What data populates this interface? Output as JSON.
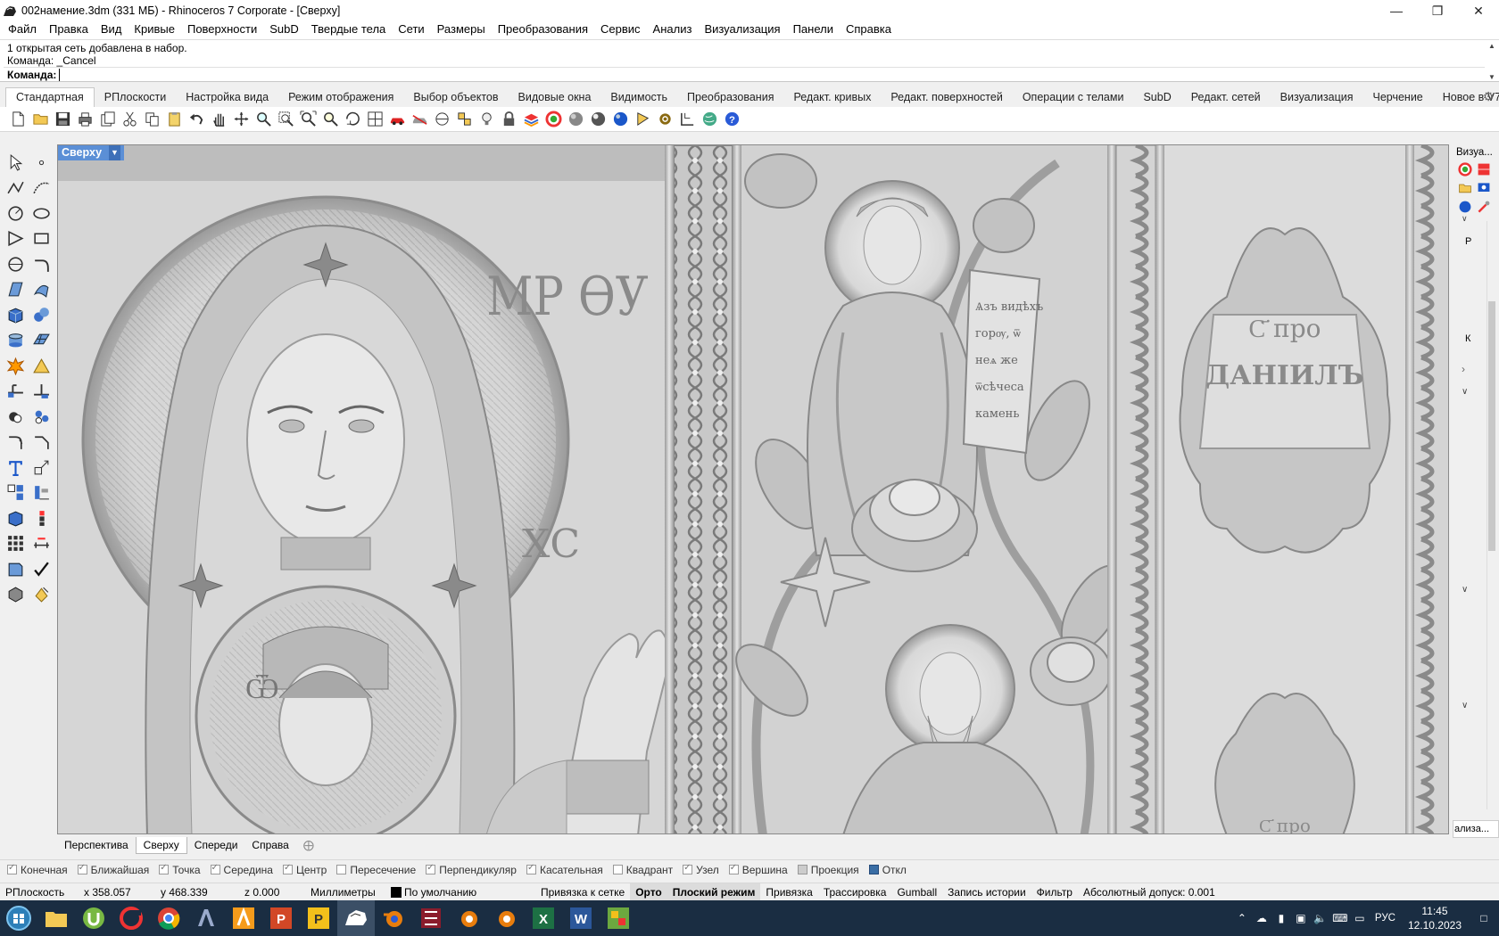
{
  "window": {
    "title": "002намение.3dm (331 МБ) - Rhinoceros 7 Corporate - [Сверху]"
  },
  "menu": [
    "Файл",
    "Правка",
    "Вид",
    "Кривые",
    "Поверхности",
    "SubD",
    "Твердые тела",
    "Сети",
    "Размеры",
    "Преобразования",
    "Сервис",
    "Анализ",
    "Визуализация",
    "Панели",
    "Справка"
  ],
  "command": {
    "history": [
      "1 открытая сеть добавлена в набор.",
      "Команда: _Cancel"
    ],
    "prompt_label": "Команда:",
    "input_value": ""
  },
  "toolbar_tabs": [
    "Стандартная",
    "РПлоскости",
    "Настройка вида",
    "Режим отображения",
    "Выбор объектов",
    "Видовые окна",
    "Видимость",
    "Преобразования",
    "Редакт. кривых",
    "Редакт. поверхностей",
    "Операции с телами",
    "SubD",
    "Редакт. сетей",
    "Визуализация",
    "Черчение",
    "Новое в V7"
  ],
  "active_tab": "Стандартная",
  "toolbar_icons": [
    "new-file-icon",
    "open-folder-icon",
    "save-icon",
    "print-icon",
    "import-icon",
    "cut-icon",
    "copy-icon",
    "paste-icon",
    "undo-icon",
    "pan-hand-icon",
    "rotate-view-icon",
    "zoom-icon",
    "zoom-window-icon",
    "zoom-extents-icon",
    "zoom-selected-icon",
    "zoom-dynamic-icon",
    "four-viewports-icon",
    "car-icon",
    "split-car-icon",
    "circle-target-icon",
    "grid-points-icon",
    "light-bulb-icon",
    "lock-icon",
    "layers-icon",
    "color-wheel-icon",
    "sphere-icon",
    "render-sphere-icon",
    "blue-sphere-icon",
    "properties-icon",
    "gear-icon",
    "dimension-icon",
    "earth-icon",
    "help-icon"
  ],
  "left_tools": [
    "select-arrow-icon",
    "point-icon",
    "polyline-icon",
    "curve-points-icon",
    "circle-icon",
    "arc-icon",
    "triangle-icon",
    "rectangle-icon",
    "ellipse-icon",
    "spiral-icon",
    "surface-pts-icon",
    "surface-icon",
    "box-icon",
    "spheres-icon",
    "cylinder-icon",
    "mesh-icon",
    "explode-icon",
    "extrude-icon",
    "trim-icon",
    "split-icon",
    "boolean-icon",
    "group-icon",
    "fillet-icon",
    "chamfer-icon",
    "text-icon",
    "transform-icon",
    "array-icon",
    "scale-icon",
    "box-edit-icon",
    "blocks-icon",
    "grid-array-icon",
    "dims-icon",
    "ortho-icon",
    "check-icon",
    "solid-icon",
    "paint-icon"
  ],
  "viewport": {
    "label": "Сверху",
    "scene_text": {
      "monogram_mary": "МР ѲУ",
      "monogram_christ": "ХС",
      "iota": "Ѿ",
      "scroll_text": "Ѧзъ видѣхъ горѹ, ѿ неѧ же ѿсѣчеса камень",
      "cartouche_line1": "С҃ про",
      "cartouche_line2": "ДАНІИЛЪ",
      "partial_label": "С҃ про"
    }
  },
  "right_panel": {
    "title": "Визуа...",
    "bottom_label": "ализа...",
    "letters": [
      "Р",
      "К"
    ]
  },
  "viewport_tabs": [
    "Перспектива",
    "Сверху",
    "Спереди",
    "Справа"
  ],
  "active_viewport_tab": "Сверху",
  "osnaps": [
    {
      "label": "Конечная",
      "checked": true
    },
    {
      "label": "Ближайшая",
      "checked": true
    },
    {
      "label": "Точка",
      "checked": true
    },
    {
      "label": "Середина",
      "checked": true
    },
    {
      "label": "Центр",
      "checked": true
    },
    {
      "label": "Пересечение",
      "checked": false
    },
    {
      "label": "Перпендикуляр",
      "checked": true
    },
    {
      "label": "Касательная",
      "checked": true
    },
    {
      "label": "Квадрант",
      "checked": false
    },
    {
      "label": "Узел",
      "checked": true
    },
    {
      "label": "Вершина",
      "checked": true
    },
    {
      "label": "Проекция",
      "checked": false
    },
    {
      "label": "Откл",
      "checked": false,
      "blue": true
    }
  ],
  "status": {
    "cplane": "РПлоскость",
    "x": "x 358.057",
    "y": "y 468.339",
    "z": "z 0.000",
    "units": "Миллиметры",
    "layer": "По умолчанию",
    "grid_snap": "Привязка к сетке",
    "ortho": "Орто",
    "planar": "Плоский режим",
    "osnap": "Привязка",
    "smarttrack": "Трассировка",
    "gumball": "Gumball",
    "history": "Запись истории",
    "filter": "Фильтр",
    "tolerance": "Абсолютный допуск: 0.001"
  },
  "taskbar": {
    "apps": [
      "start-orb-icon",
      "file-explorer-icon",
      "utorrent-icon",
      "ccleaner-icon",
      "chrome-icon",
      "artcam-icon",
      "aimp-icon",
      "powerpoint-app-icon",
      "photoprinter-icon",
      "rhino-icon",
      "blender-icon",
      "media-icon",
      "blender-2-icon",
      "blender-3-icon",
      "excel-icon",
      "word-icon",
      "greenshot-icon"
    ],
    "language": "РУС",
    "time": "11:45",
    "date": "12.10.2023"
  },
  "colors": {
    "viewport_label_bg": "#5b8fd6",
    "taskbar_bg": "#1a2d42",
    "relief_bg": "#d4d4d4"
  }
}
